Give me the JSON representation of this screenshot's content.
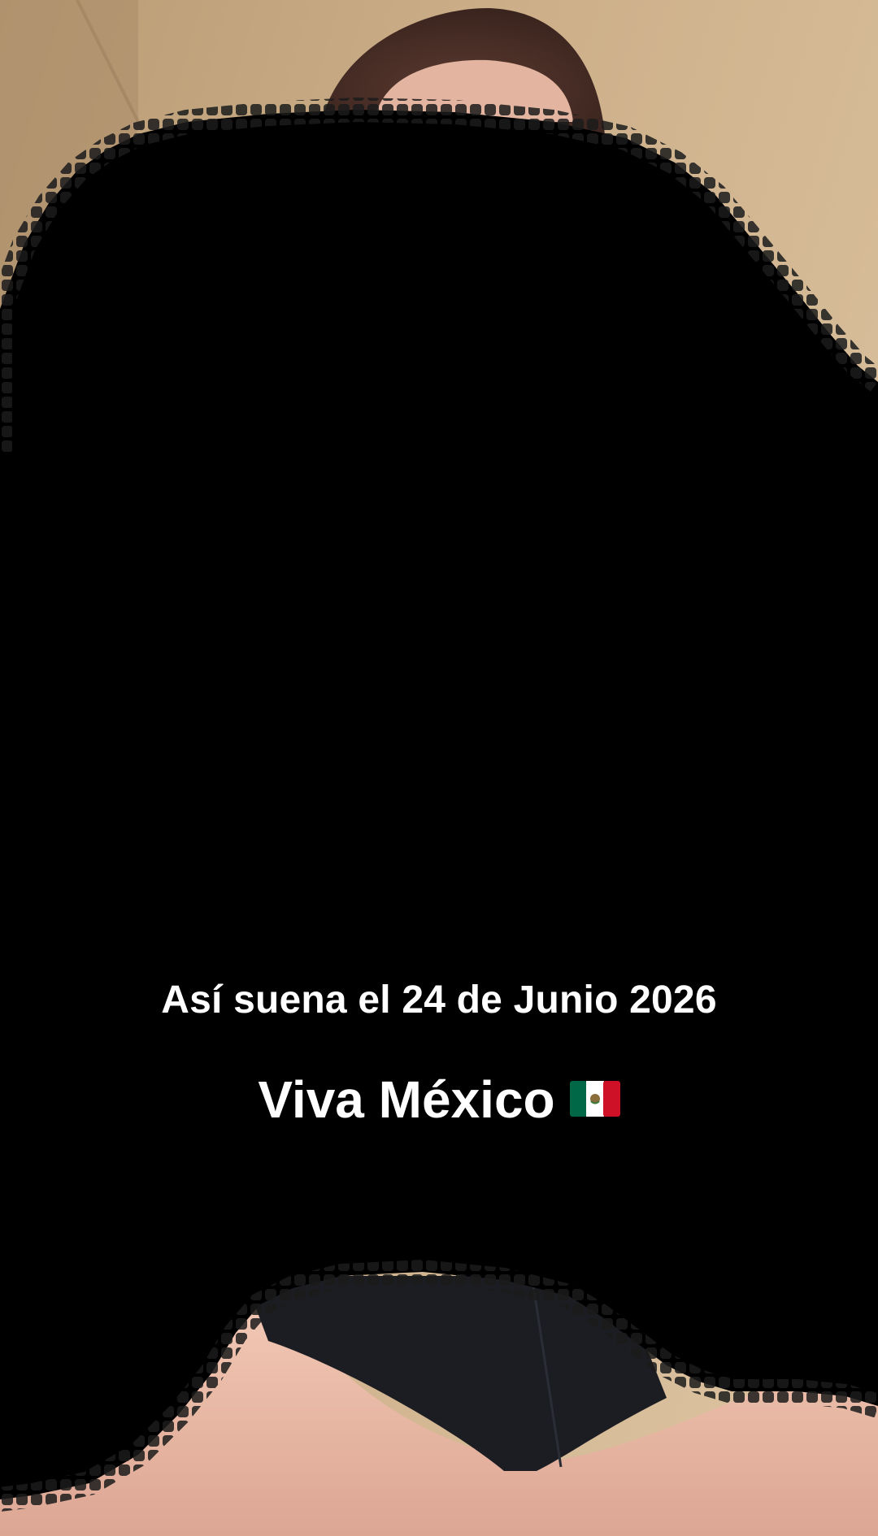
{
  "captions": {
    "line1": "Así suena el 24 de Junio 2026",
    "line2": "Viva México"
  },
  "flag": {
    "icon": "mexico-flag-icon",
    "colors": {
      "green": "#006847",
      "white": "#ffffff",
      "red": "#ce1126"
    }
  },
  "colors": {
    "wall_top": "#c8a97c",
    "wall_right": "#d4b690",
    "skin": "#e7b6a1",
    "hair": "#4a2f27",
    "obscured_region": "#000000",
    "shorts": "#1a1c22"
  }
}
